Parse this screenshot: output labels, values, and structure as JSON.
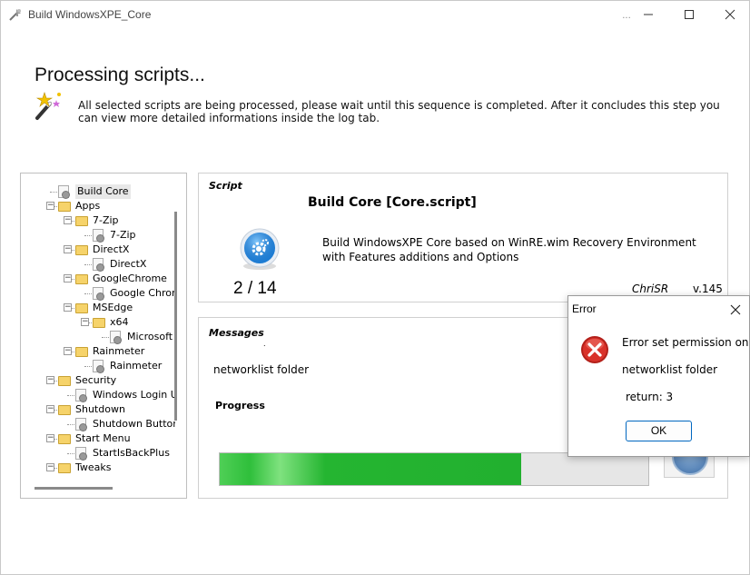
{
  "window": {
    "title": "Build WindowsXPE_Core",
    "title_extra": "..."
  },
  "header": {
    "title": "Processing scripts...",
    "description": "All selected scripts are being processed, please wait until this sequence is completed. After it concludes this step you can view more detailed informations inside the log tab."
  },
  "tree": {
    "items": [
      {
        "label": "Build Core",
        "type": "script",
        "level": 0,
        "selected": true
      },
      {
        "label": "Apps",
        "type": "folder",
        "level": 0
      },
      {
        "label": "7-Zip",
        "type": "folder",
        "level": 1
      },
      {
        "label": "7-Zip",
        "type": "script",
        "level": 2
      },
      {
        "label": "DirectX",
        "type": "folder",
        "level": 1
      },
      {
        "label": "DirectX",
        "type": "script",
        "level": 2
      },
      {
        "label": "GoogleChrome",
        "type": "folder",
        "level": 1
      },
      {
        "label": "Google Chrom",
        "type": "script",
        "level": 2
      },
      {
        "label": "MSEdge",
        "type": "folder",
        "level": 1
      },
      {
        "label": "x64",
        "type": "folder",
        "level": 2
      },
      {
        "label": "Microsoft",
        "type": "script",
        "level": 3
      },
      {
        "label": "Rainmeter",
        "type": "folder",
        "level": 1
      },
      {
        "label": "Rainmeter",
        "type": "script",
        "level": 2
      },
      {
        "label": "Security",
        "type": "folder",
        "level": 0
      },
      {
        "label": "Windows Login U",
        "type": "script",
        "level": 1
      },
      {
        "label": "Shutdown",
        "type": "folder",
        "level": 0
      },
      {
        "label": "Shutdown Button",
        "type": "script",
        "level": 1
      },
      {
        "label": "Start Menu",
        "type": "folder",
        "level": 0
      },
      {
        "label": "StartIsBackPlus",
        "type": "script",
        "level": 1
      },
      {
        "label": "Tweaks",
        "type": "folder",
        "level": 0
      }
    ]
  },
  "script": {
    "section_label": "Script",
    "name": "Build Core [Core.script]",
    "description": "Build WindowsXPE Core based on WinRE.wim Recovery Environment with Features additions and Options",
    "counter": "2 / 14",
    "author": "ChriSR",
    "version": "v.145"
  },
  "messages": {
    "section_label": "Messages",
    "dot": ".",
    "text": "networklist folder",
    "progress_label": "Progress",
    "progress_fraction": 0.703
  },
  "dialog": {
    "title": "Error",
    "line1": "Error set permission on",
    "line2": "networklist folder",
    "line3": "return: 3",
    "ok_label": "OK"
  },
  "colors": {
    "progress": "#2fbf3b",
    "error": "#c42b1c",
    "accent": "#0067c0"
  }
}
